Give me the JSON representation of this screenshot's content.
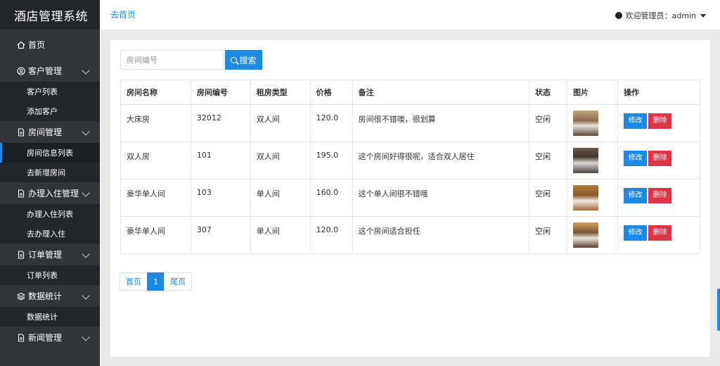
{
  "brand": "酒店管理系统",
  "nav": {
    "home": "首页",
    "groups": [
      {
        "label": "客户管理",
        "subs": [
          "客户列表",
          "添加客户"
        ]
      },
      {
        "label": "房间管理",
        "subs": [
          "房间信息列表",
          "去新增房间"
        ]
      },
      {
        "label": "办理入住管理",
        "subs": [
          "办理入住列表",
          "去办理入住"
        ]
      },
      {
        "label": "订单管理",
        "subs": [
          "订单列表"
        ]
      },
      {
        "label": "数据统计",
        "subs": [
          "数据统计"
        ]
      },
      {
        "label": "新闻管理",
        "subs": []
      }
    ],
    "active": "房间信息列表"
  },
  "topbar": {
    "home_link": "去首页",
    "welcome": "欢迎管理员：admin"
  },
  "search": {
    "placeholder": "房间编号",
    "button": "搜索"
  },
  "table": {
    "headers": [
      "房间名称",
      "房间编号",
      "租房类型",
      "价格",
      "备注",
      "状态",
      "图片",
      "操作"
    ],
    "rows": [
      {
        "name": "大床房",
        "number": "32012",
        "type": "双人间",
        "price": "120.0",
        "note": "房间很不错噢，很划算",
        "status": "空闲",
        "image": "room-photo-1"
      },
      {
        "name": "双人房",
        "number": "101",
        "type": "双人间",
        "price": "195.0",
        "note": "这个房间好得很呢，适合双人居住",
        "status": "空闲",
        "image": "room-photo-2"
      },
      {
        "name": "豪华单人间",
        "number": "103",
        "type": "单人间",
        "price": "160.0",
        "note": "这个单人间很不错哦",
        "status": "空闲",
        "image": "room-photo-3"
      },
      {
        "name": "豪华单人间",
        "number": "307",
        "type": "单人间",
        "price": "120.0",
        "note": "这个房间适合担任",
        "status": "空闲",
        "image": "room-photo-4"
      }
    ],
    "edit_label": "修改",
    "delete_label": "删除"
  },
  "pager": {
    "first": "首页",
    "current": "1",
    "last": "尾页"
  },
  "colors": {
    "sidebar": "#32343a",
    "sidebar_header": "#23252a",
    "primary": "#1e88e5",
    "danger": "#dc3545"
  }
}
